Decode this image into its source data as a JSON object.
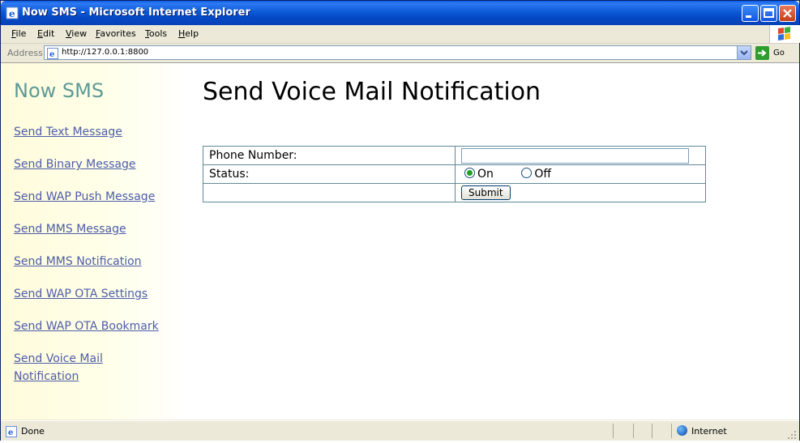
{
  "window": {
    "title": "Now SMS - Microsoft Internet Explorer"
  },
  "menu": {
    "items": [
      {
        "label": "File",
        "key": "F",
        "rest": "ile"
      },
      {
        "label": "Edit",
        "key": "E",
        "rest": "dit"
      },
      {
        "label": "View",
        "key": "V",
        "rest": "iew"
      },
      {
        "label": "Favorites",
        "key": "F",
        "rest": "avorites"
      },
      {
        "label": "Tools",
        "key": "T",
        "rest": "ools"
      },
      {
        "label": "Help",
        "key": "H",
        "rest": "elp"
      }
    ]
  },
  "address": {
    "label": "Address",
    "url": "http://127.0.0.1:8800",
    "go_label": "Go"
  },
  "sidebar": {
    "brand": "Now SMS",
    "links": [
      "Send Text Message",
      "Send Binary Message",
      "Send WAP Push Message",
      "Send MMS Message",
      "Send MMS Notification",
      "Send WAP OTA Settings",
      "Send WAP OTA Bookmark",
      "Send Voice Mail Notification"
    ]
  },
  "main": {
    "title": "Send Voice Mail Notification",
    "phone_label": "Phone Number:",
    "phone_value": "",
    "status_label": "Status:",
    "status_options": [
      "On",
      "Off"
    ],
    "status_selected": "On",
    "submit_label": "Submit"
  },
  "statusbar": {
    "text": "Done",
    "zone": "Internet"
  },
  "colors": {
    "sidebar_link": "#4d5da8",
    "brand": "#5e9a96",
    "table_border": "#5e8a96",
    "titlebar": "#0548c5"
  }
}
